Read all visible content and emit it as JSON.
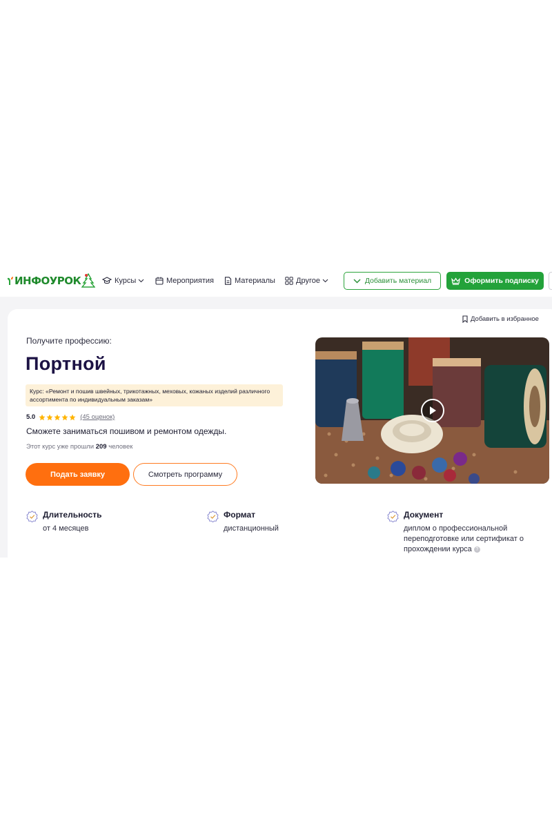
{
  "header": {
    "logo_text": "ИНФОУРОК",
    "nav": [
      {
        "label": "Курсы",
        "icon": "graduation-cap-icon",
        "dropdown": true
      },
      {
        "label": "Мероприятия",
        "icon": "calendar-icon",
        "dropdown": false
      },
      {
        "label": "Материалы",
        "icon": "document-icon",
        "dropdown": false
      },
      {
        "label": "Другое",
        "icon": "grid-icon",
        "dropdown": true
      }
    ],
    "add_material_label": "Добавить материал",
    "subscribe_label": "Оформить подписку"
  },
  "favorite_label": "Добавить в избранное",
  "hero": {
    "kicker": "Получите профессию:",
    "title": "Портной",
    "course_note": "Курс: «Ремонт и пошив швейных, трикотажных, меховых, кожаных изделий различного ассортимента по индивидуальным заказам»",
    "rating_value": "5.0",
    "rating_stars": 5,
    "reviews_label": "(45 оценок)",
    "tagline": "Сможете заниматься пошивом и ремонтом одежды.",
    "passed_prefix": "Этот курс уже прошли",
    "passed_count": "209",
    "passed_suffix": "человек",
    "apply_label": "Подать заявку",
    "program_label": "Смотреть программу"
  },
  "features": [
    {
      "title": "Длительность",
      "value": "от 4 месяцев"
    },
    {
      "title": "Формат",
      "value": "дистанционный"
    },
    {
      "title": "Документ",
      "value": "диплом о профессиональной переподготовке или сертификат о прохождении курса"
    }
  ],
  "colors": {
    "brand_green": "#23a23a",
    "accent_orange": "#ff6f0f",
    "title_navy": "#1c1244",
    "note_bg": "#fdf1d9",
    "star": "#ffb400"
  }
}
